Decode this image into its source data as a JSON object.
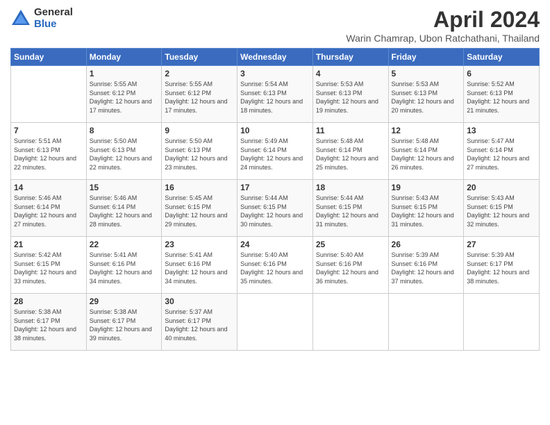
{
  "header": {
    "logo_general": "General",
    "logo_blue": "Blue",
    "title": "April 2024",
    "subtitle": "Warin Chamrap, Ubon Ratchathani, Thailand"
  },
  "days_of_week": [
    "Sunday",
    "Monday",
    "Tuesday",
    "Wednesday",
    "Thursday",
    "Friday",
    "Saturday"
  ],
  "weeks": [
    [
      {
        "day": "",
        "sunrise": "",
        "sunset": "",
        "daylight": ""
      },
      {
        "day": "1",
        "sunrise": "Sunrise: 5:55 AM",
        "sunset": "Sunset: 6:12 PM",
        "daylight": "Daylight: 12 hours and 17 minutes."
      },
      {
        "day": "2",
        "sunrise": "Sunrise: 5:55 AM",
        "sunset": "Sunset: 6:12 PM",
        "daylight": "Daylight: 12 hours and 17 minutes."
      },
      {
        "day": "3",
        "sunrise": "Sunrise: 5:54 AM",
        "sunset": "Sunset: 6:13 PM",
        "daylight": "Daylight: 12 hours and 18 minutes."
      },
      {
        "day": "4",
        "sunrise": "Sunrise: 5:53 AM",
        "sunset": "Sunset: 6:13 PM",
        "daylight": "Daylight: 12 hours and 19 minutes."
      },
      {
        "day": "5",
        "sunrise": "Sunrise: 5:53 AM",
        "sunset": "Sunset: 6:13 PM",
        "daylight": "Daylight: 12 hours and 20 minutes."
      },
      {
        "day": "6",
        "sunrise": "Sunrise: 5:52 AM",
        "sunset": "Sunset: 6:13 PM",
        "daylight": "Daylight: 12 hours and 21 minutes."
      }
    ],
    [
      {
        "day": "7",
        "sunrise": "Sunrise: 5:51 AM",
        "sunset": "Sunset: 6:13 PM",
        "daylight": "Daylight: 12 hours and 22 minutes."
      },
      {
        "day": "8",
        "sunrise": "Sunrise: 5:50 AM",
        "sunset": "Sunset: 6:13 PM",
        "daylight": "Daylight: 12 hours and 22 minutes."
      },
      {
        "day": "9",
        "sunrise": "Sunrise: 5:50 AM",
        "sunset": "Sunset: 6:13 PM",
        "daylight": "Daylight: 12 hours and 23 minutes."
      },
      {
        "day": "10",
        "sunrise": "Sunrise: 5:49 AM",
        "sunset": "Sunset: 6:14 PM",
        "daylight": "Daylight: 12 hours and 24 minutes."
      },
      {
        "day": "11",
        "sunrise": "Sunrise: 5:48 AM",
        "sunset": "Sunset: 6:14 PM",
        "daylight": "Daylight: 12 hours and 25 minutes."
      },
      {
        "day": "12",
        "sunrise": "Sunrise: 5:48 AM",
        "sunset": "Sunset: 6:14 PM",
        "daylight": "Daylight: 12 hours and 26 minutes."
      },
      {
        "day": "13",
        "sunrise": "Sunrise: 5:47 AM",
        "sunset": "Sunset: 6:14 PM",
        "daylight": "Daylight: 12 hours and 27 minutes."
      }
    ],
    [
      {
        "day": "14",
        "sunrise": "Sunrise: 5:46 AM",
        "sunset": "Sunset: 6:14 PM",
        "daylight": "Daylight: 12 hours and 27 minutes."
      },
      {
        "day": "15",
        "sunrise": "Sunrise: 5:46 AM",
        "sunset": "Sunset: 6:14 PM",
        "daylight": "Daylight: 12 hours and 28 minutes."
      },
      {
        "day": "16",
        "sunrise": "Sunrise: 5:45 AM",
        "sunset": "Sunset: 6:15 PM",
        "daylight": "Daylight: 12 hours and 29 minutes."
      },
      {
        "day": "17",
        "sunrise": "Sunrise: 5:44 AM",
        "sunset": "Sunset: 6:15 PM",
        "daylight": "Daylight: 12 hours and 30 minutes."
      },
      {
        "day": "18",
        "sunrise": "Sunrise: 5:44 AM",
        "sunset": "Sunset: 6:15 PM",
        "daylight": "Daylight: 12 hours and 31 minutes."
      },
      {
        "day": "19",
        "sunrise": "Sunrise: 5:43 AM",
        "sunset": "Sunset: 6:15 PM",
        "daylight": "Daylight: 12 hours and 31 minutes."
      },
      {
        "day": "20",
        "sunrise": "Sunrise: 5:43 AM",
        "sunset": "Sunset: 6:15 PM",
        "daylight": "Daylight: 12 hours and 32 minutes."
      }
    ],
    [
      {
        "day": "21",
        "sunrise": "Sunrise: 5:42 AM",
        "sunset": "Sunset: 6:15 PM",
        "daylight": "Daylight: 12 hours and 33 minutes."
      },
      {
        "day": "22",
        "sunrise": "Sunrise: 5:41 AM",
        "sunset": "Sunset: 6:16 PM",
        "daylight": "Daylight: 12 hours and 34 minutes."
      },
      {
        "day": "23",
        "sunrise": "Sunrise: 5:41 AM",
        "sunset": "Sunset: 6:16 PM",
        "daylight": "Daylight: 12 hours and 34 minutes."
      },
      {
        "day": "24",
        "sunrise": "Sunrise: 5:40 AM",
        "sunset": "Sunset: 6:16 PM",
        "daylight": "Daylight: 12 hours and 35 minutes."
      },
      {
        "day": "25",
        "sunrise": "Sunrise: 5:40 AM",
        "sunset": "Sunset: 6:16 PM",
        "daylight": "Daylight: 12 hours and 36 minutes."
      },
      {
        "day": "26",
        "sunrise": "Sunrise: 5:39 AM",
        "sunset": "Sunset: 6:16 PM",
        "daylight": "Daylight: 12 hours and 37 minutes."
      },
      {
        "day": "27",
        "sunrise": "Sunrise: 5:39 AM",
        "sunset": "Sunset: 6:17 PM",
        "daylight": "Daylight: 12 hours and 38 minutes."
      }
    ],
    [
      {
        "day": "28",
        "sunrise": "Sunrise: 5:38 AM",
        "sunset": "Sunset: 6:17 PM",
        "daylight": "Daylight: 12 hours and 38 minutes."
      },
      {
        "day": "29",
        "sunrise": "Sunrise: 5:38 AM",
        "sunset": "Sunset: 6:17 PM",
        "daylight": "Daylight: 12 hours and 39 minutes."
      },
      {
        "day": "30",
        "sunrise": "Sunrise: 5:37 AM",
        "sunset": "Sunset: 6:17 PM",
        "daylight": "Daylight: 12 hours and 40 minutes."
      },
      {
        "day": "",
        "sunrise": "",
        "sunset": "",
        "daylight": ""
      },
      {
        "day": "",
        "sunrise": "",
        "sunset": "",
        "daylight": ""
      },
      {
        "day": "",
        "sunrise": "",
        "sunset": "",
        "daylight": ""
      },
      {
        "day": "",
        "sunrise": "",
        "sunset": "",
        "daylight": ""
      }
    ]
  ]
}
